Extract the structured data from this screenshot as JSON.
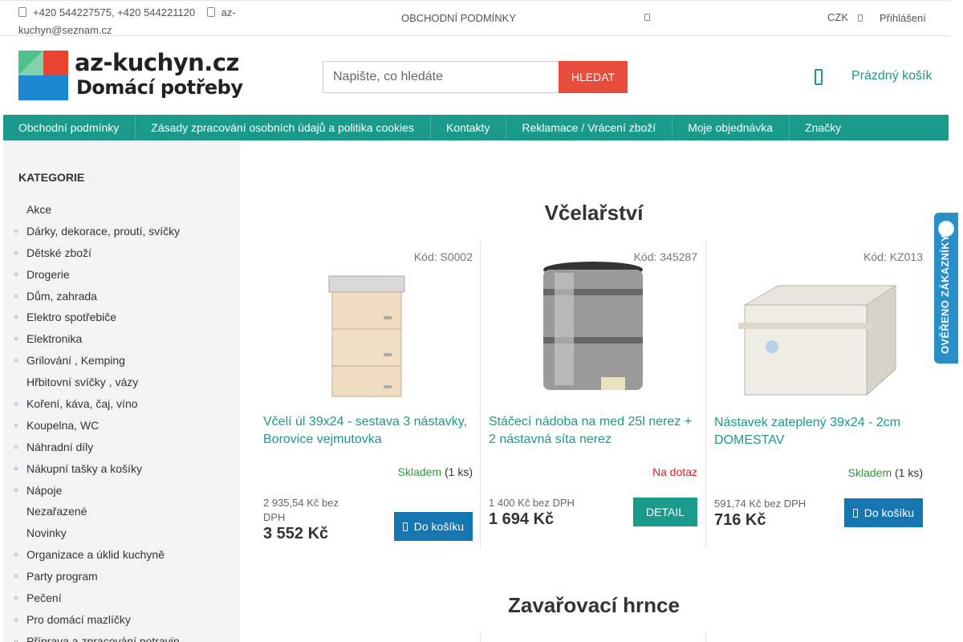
{
  "topbar": {
    "contact_phones": "+420 544227575, +420 544221120",
    "contact_email": "az-kuchyn@seznam.cz",
    "terms_link": "OBCHODNÍ PODMÍNKY",
    "currency": "CZK",
    "login": "Přihlášení"
  },
  "header": {
    "logo_line1": "az-kuchyn.cz",
    "logo_line2": "Domácí potřeby",
    "search_placeholder": "Napište, co hledáte",
    "search_button": "HLEDAT",
    "cart_label": "Prázdný košík"
  },
  "nav": {
    "items": [
      "Obchodní podmínky",
      "Zásady zpracování osobních údajů a politika cookies",
      "Kontakty",
      "Reklamace / Vrácení zboží",
      "Moje objednávka",
      "Značky"
    ]
  },
  "sidebar": {
    "title": "KATEGORIE",
    "items": [
      "Akce",
      "Dárky, dekorace, proutí, svíčky",
      "Dětské zboží",
      "Drogerie",
      "Dům, zahrada",
      "Elektro spotřebiče",
      "Elektronika",
      "Grilování , Kemping",
      "Hřbitovní svíčky , vázy",
      "Koření, káva, čaj, víno",
      "Koupelna, WC",
      "Náhradní díly",
      "Nákupní tašky a košíky",
      "Nápoje",
      "Nezařazené",
      "Novinky",
      "Organizace a úklid kuchyně",
      "Party program",
      "Pečení",
      "Pro domácí mazlíčky",
      "Příprava a zpracování potravin"
    ]
  },
  "sections": [
    {
      "title": "Včelařství",
      "products": [
        {
          "code": "Kód: S0002",
          "name": "Včelí úl 39x24 - sestava 3 nástavky, Borovice vejmutovka",
          "stock_status": "Skladem",
          "stock_qty": "(1 ks)",
          "price_net": "2 935,54 Kč bez DPH",
          "price": "3 552 Kč",
          "button": "Do košíku"
        },
        {
          "code": "Kód: 345287",
          "name": "Stáčecí nádoba na med 25l nerez + 2 nástavná síta nerez",
          "stock_status": "Na dotaz",
          "stock_qty": "",
          "price_net": "1 400 Kč bez DPH",
          "price": "1 694 Kč",
          "button": "DETAIL"
        },
        {
          "code": "Kód: KZ013",
          "name": "Nástavek zateplený 39x24 - 2cm DOMESTAV",
          "stock_status": "Skladem",
          "stock_qty": "(1 ks)",
          "price_net": "591,74 Kč bez DPH",
          "price": "716 Kč",
          "button": "Do košíku"
        }
      ]
    },
    {
      "title": "Zavařovací hrnce"
    }
  ],
  "badge": {
    "label": "OVĚŘENO ZÁKAZNÍKY"
  },
  "colors": {
    "accent": "#1a9a8a",
    "search_button": "#e74c3c",
    "cart_button": "#1776b0",
    "in_stock": "#2a9a3a",
    "on_request": "#d62020",
    "badge": "#2a8fc7"
  },
  "icons": {
    "phone": "phone-icon",
    "email": "email-icon",
    "cart": "cart-icon",
    "user": "user-icon"
  }
}
